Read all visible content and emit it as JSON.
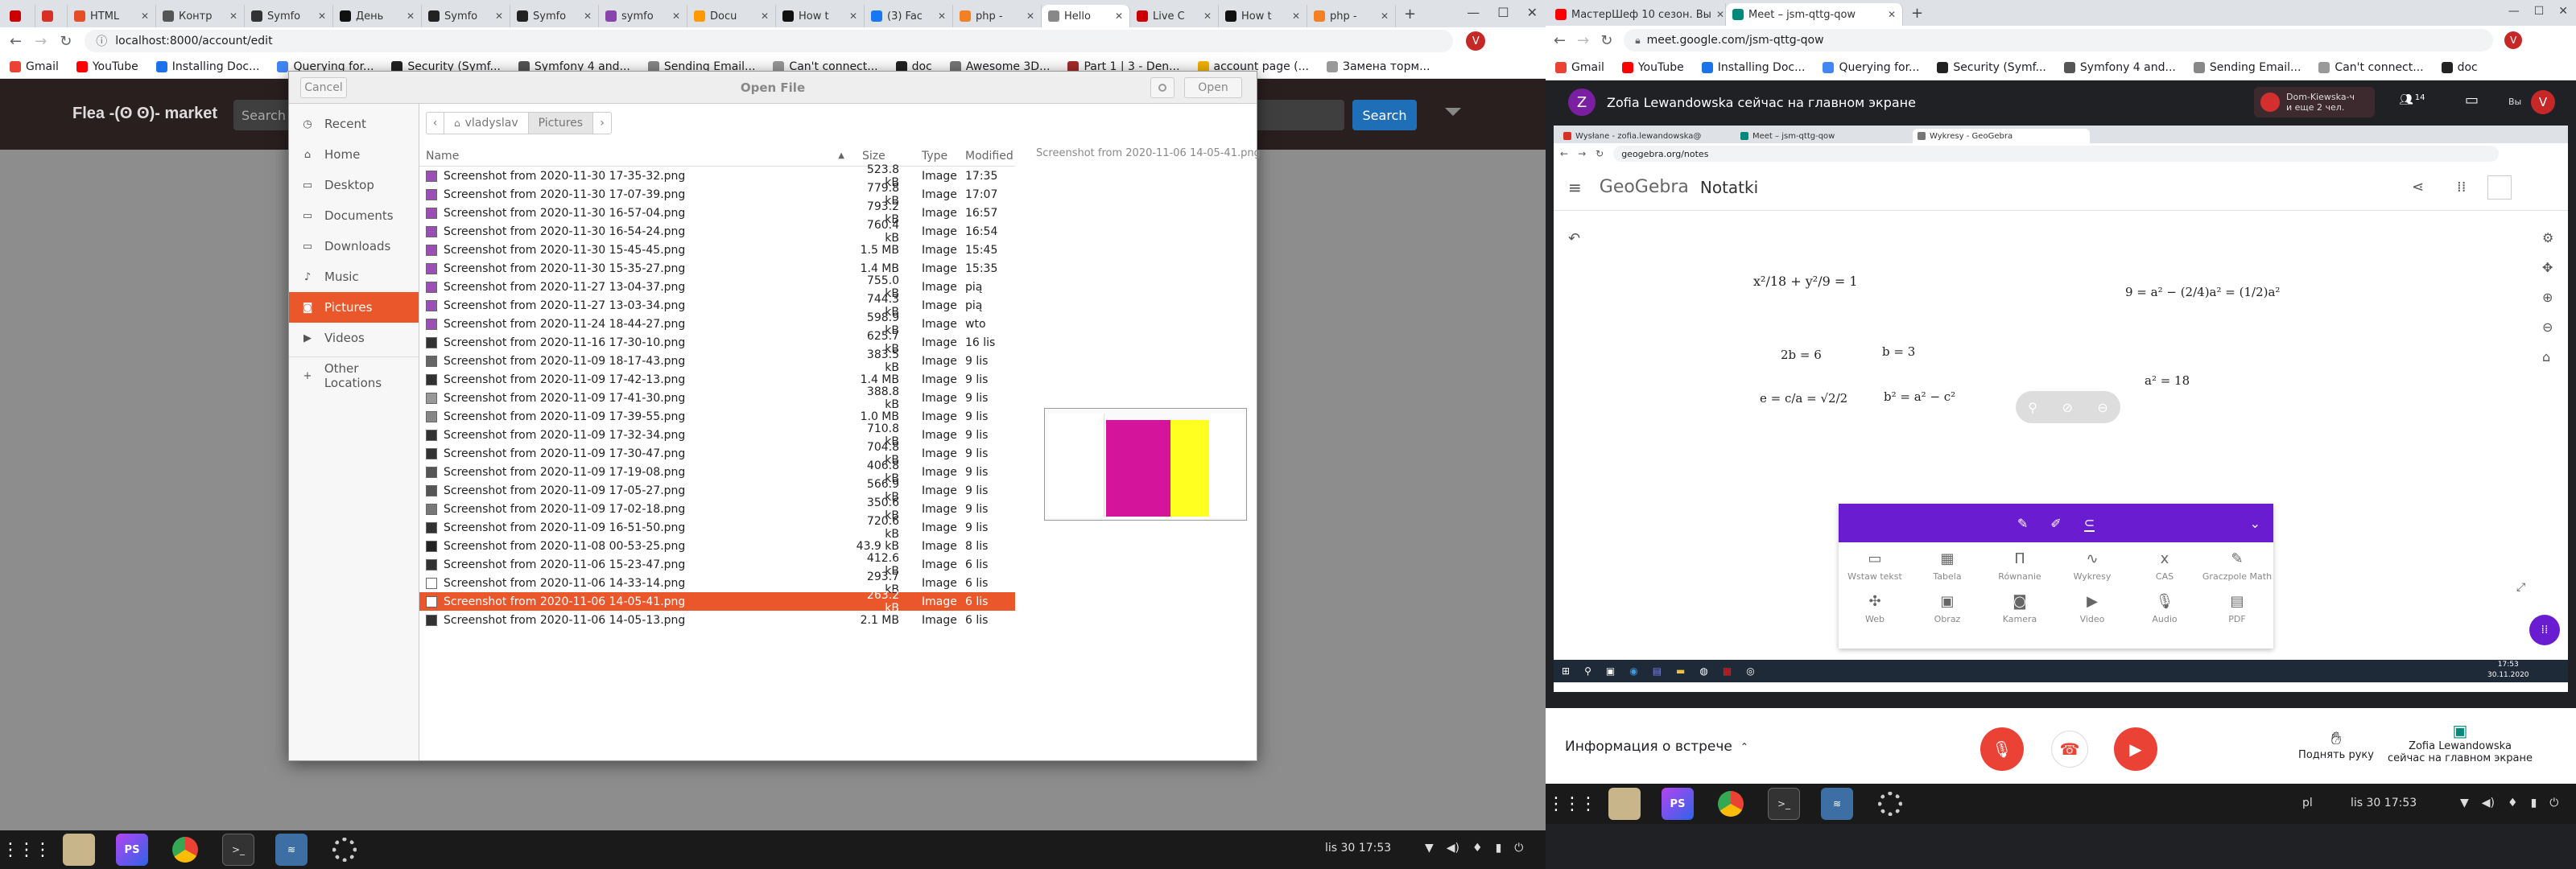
{
  "left_browser": {
    "tabs": [
      {
        "label": "",
        "color": "#cc0000"
      },
      {
        "label": "",
        "color": "#d93025"
      },
      {
        "label": "HTML",
        "color": "#e44d26"
      },
      {
        "label": "Контр",
        "color": "#555555"
      },
      {
        "label": "Symfo",
        "color": "#333333"
      },
      {
        "label": "День",
        "color": "#111111"
      },
      {
        "label": "Symfo",
        "color": "#222222"
      },
      {
        "label": "Symfo",
        "color": "#222222"
      },
      {
        "label": "symfo",
        "color": "#8844aa"
      },
      {
        "label": "Docu",
        "color": "#ff9900"
      },
      {
        "label": "How t",
        "color": "#111111"
      },
      {
        "label": "(3) Fac",
        "color": "#1877f2"
      },
      {
        "label": "php -",
        "color": "#f48024"
      },
      {
        "label": "Hello",
        "color": "#888888"
      },
      {
        "label": "Live C",
        "color": "#cc0000"
      },
      {
        "label": "How t",
        "color": "#111111"
      },
      {
        "label": "php -",
        "color": "#f48024"
      }
    ],
    "url": "localhost:8000/account/edit",
    "bookmarks": [
      "Gmail",
      "YouTube",
      "Installing Doc...",
      "Querying for...",
      "Security (Symf...",
      "Symfony 4 and...",
      "Sending Email...",
      "Can't connect...",
      "doc",
      "Awesome 3D...",
      "Part 1 | 3 - Den...",
      "account page (...",
      "Замена торм..."
    ],
    "site": {
      "logo": "Flea -(ʘ ʘ)- market",
      "search_placeholder": "Search",
      "search_button": "Search"
    }
  },
  "file_dialog": {
    "title": "Open File",
    "cancel_label": "Cancel",
    "open_label": "Open",
    "sidebar": [
      {
        "label": "Recent",
        "icon": "clock-icon"
      },
      {
        "label": "Home",
        "icon": "home-icon"
      },
      {
        "label": "Desktop",
        "icon": "folder-icon"
      },
      {
        "label": "Documents",
        "icon": "folder-icon"
      },
      {
        "label": "Downloads",
        "icon": "folder-icon"
      },
      {
        "label": "Music",
        "icon": "music-icon"
      },
      {
        "label": "Pictures",
        "icon": "camera-icon"
      },
      {
        "label": "Videos",
        "icon": "video-icon"
      },
      {
        "label": "Other Locations",
        "icon": "plus-icon"
      }
    ],
    "active_sidebar": "Pictures",
    "breadcrumb": [
      "vladyslav",
      "Pictures"
    ],
    "columns": {
      "name": "Name",
      "size": "Size",
      "type": "Type",
      "modified": "Modified"
    },
    "files": [
      {
        "name": "Screenshot from 2020-11-30 17-35-32.png",
        "size": "523.8 kB",
        "type": "Image",
        "modified": "17:35"
      },
      {
        "name": "Screenshot from 2020-11-30 17-07-39.png",
        "size": "779.8 kB",
        "type": "Image",
        "modified": "17:07"
      },
      {
        "name": "Screenshot from 2020-11-30 16-57-04.png",
        "size": "793.2 kB",
        "type": "Image",
        "modified": "16:57"
      },
      {
        "name": "Screenshot from 2020-11-30 16-54-24.png",
        "size": "760.4 kB",
        "type": "Image",
        "modified": "16:54"
      },
      {
        "name": "Screenshot from 2020-11-30 15-45-45.png",
        "size": "1.5 MB",
        "type": "Image",
        "modified": "15:45"
      },
      {
        "name": "Screenshot from 2020-11-30 15-35-27.png",
        "size": "1.4 MB",
        "type": "Image",
        "modified": "15:35"
      },
      {
        "name": "Screenshot from 2020-11-27 13-04-37.png",
        "size": "755.0 kB",
        "type": "Image",
        "modified": "pią"
      },
      {
        "name": "Screenshot from 2020-11-27 13-03-34.png",
        "size": "744.3 kB",
        "type": "Image",
        "modified": "pią"
      },
      {
        "name": "Screenshot from 2020-11-24 18-44-27.png",
        "size": "598.9 kB",
        "type": "Image",
        "modified": "wto"
      },
      {
        "name": "Screenshot from 2020-11-16 17-30-10.png",
        "size": "625.7 kB",
        "type": "Image",
        "modified": "16 lis"
      },
      {
        "name": "Screenshot from 2020-11-09 18-17-43.png",
        "size": "383.5 kB",
        "type": "Image",
        "modified": "9 lis"
      },
      {
        "name": "Screenshot from 2020-11-09 17-42-13.png",
        "size": "1.4 MB",
        "type": "Image",
        "modified": "9 lis"
      },
      {
        "name": "Screenshot from 2020-11-09 17-41-30.png",
        "size": "388.8 kB",
        "type": "Image",
        "modified": "9 lis"
      },
      {
        "name": "Screenshot from 2020-11-09 17-39-55.png",
        "size": "1.0 MB",
        "type": "Image",
        "modified": "9 lis"
      },
      {
        "name": "Screenshot from 2020-11-09 17-32-34.png",
        "size": "710.8 kB",
        "type": "Image",
        "modified": "9 lis"
      },
      {
        "name": "Screenshot from 2020-11-09 17-30-47.png",
        "size": "704.8 kB",
        "type": "Image",
        "modified": "9 lis"
      },
      {
        "name": "Screenshot from 2020-11-09 17-19-08.png",
        "size": "406.8 kB",
        "type": "Image",
        "modified": "9 lis"
      },
      {
        "name": "Screenshot from 2020-11-09 17-05-27.png",
        "size": "566.9 kB",
        "type": "Image",
        "modified": "9 lis"
      },
      {
        "name": "Screenshot from 2020-11-09 17-02-18.png",
        "size": "350.6 kB",
        "type": "Image",
        "modified": "9 lis"
      },
      {
        "name": "Screenshot from 2020-11-09 16-51-50.png",
        "size": "720.6 kB",
        "type": "Image",
        "modified": "9 lis"
      },
      {
        "name": "Screenshot from 2020-11-08 00-53-25.png",
        "size": "43.9 kB",
        "type": "Image",
        "modified": "8 lis"
      },
      {
        "name": "Screenshot from 2020-11-06 15-23-47.png",
        "size": "412.6 kB",
        "type": "Image",
        "modified": "6 lis"
      },
      {
        "name": "Screenshot from 2020-11-06 14-33-14.png",
        "size": "293.7 kB",
        "type": "Image",
        "modified": "6 lis"
      },
      {
        "name": "Screenshot from 2020-11-06 14-05-41.png",
        "size": "263.2 kB",
        "type": "Image",
        "modified": "6 lis"
      },
      {
        "name": "Screenshot from 2020-11-06 14-05-13.png",
        "size": "2.1 MB",
        "type": "Image",
        "modified": "6 lis"
      }
    ],
    "selected_index": 23,
    "preview_title": "Screenshot from 2020-11-06 14-05-41.png"
  },
  "left_taskbar": {
    "clock": "lis 30 17:53",
    "apps": [
      "apps-grid-icon",
      "files-icon",
      "phpstorm-icon",
      "chrome-icon",
      "terminal-icon",
      "terminal2-icon",
      "settings-icon"
    ]
  },
  "right_browser": {
    "tabs": [
      {
        "label": "МастерШеф 10 сезон. Вы",
        "color": "#ff0000"
      },
      {
        "label": "Meet – jsm-qttg-qow",
        "color": "#00897b"
      }
    ],
    "url": "meet.google.com/jsm-qttg-qow",
    "bookmarks": [
      "Gmail",
      "YouTube",
      "Installing Doc...",
      "Querying for...",
      "Security (Symf...",
      "Symfony 4 and...",
      "Sending Email...",
      "Can't connect...",
      "doc"
    ],
    "avatar_letter": "V"
  },
  "meet": {
    "presenter_letter": "Z",
    "presenter_text": "Zofia Lewandowska сейчас на главном экране",
    "participant_notice": "Dom-Kiewska-ч\nи еще 2 чел.",
    "participants_count": "14",
    "you_label": "Вы",
    "avatar_letter": "V",
    "meeting_info": "Информация о встрече",
    "raise_hand": "Поднять руку",
    "presenting_label": "Zofia Lewandowska\nсейчас на главном экране"
  },
  "shared_screen": {
    "tabs": [
      {
        "label": "Wysłane - zofia.lewandowska@",
        "color": "#d93025"
      },
      {
        "label": "Meet – jsm-qttg-qow",
        "color": "#00897b"
      },
      {
        "label": "Wykresy - GeoGebra",
        "color": "#777777"
      }
    ],
    "url": "geogebra.org/notes",
    "app_name": "GeoGebra",
    "page_title": "Notatki",
    "notes": {
      "ellipse": "x²/18 + y²/9 = 1",
      "two_b": "2b = 6",
      "b": "b = 3",
      "e": "e = c/a = √2/2",
      "b_sq": "b² = a² − c²",
      "nine": "9 = a² − (2/4)a² = (1/2)a²",
      "a_sq": "a² = 18"
    },
    "tools": [
      {
        "label": "Wstaw tekst",
        "icon": "text-icon"
      },
      {
        "label": "Tabela",
        "icon": "table-icon"
      },
      {
        "label": "Równanie",
        "icon": "equation-icon"
      },
      {
        "label": "Wykresy",
        "icon": "graph-icon"
      },
      {
        "label": "CAS",
        "icon": "cas-icon"
      },
      {
        "label": "Graczpole Math",
        "icon": "math-icon"
      },
      {
        "label": "Web",
        "icon": "puzzle-icon"
      },
      {
        "label": "Obraz",
        "icon": "image-icon"
      },
      {
        "label": "Kamera",
        "icon": "camera-icon"
      },
      {
        "label": "Video",
        "icon": "video-icon"
      },
      {
        "label": "Audio",
        "icon": "mic-icon"
      },
      {
        "label": "PDF",
        "icon": "pdf-icon"
      }
    ],
    "clock": "17:53",
    "date": "30.11.2020"
  },
  "right_taskbar": {
    "lang": "pl",
    "clock": "lis 30 17:53"
  },
  "colors": {
    "accent_orange": "#e9572a",
    "geogebra_purple": "#6a1cd1",
    "meet_dark": "#202124",
    "meet_red": "#ea4335"
  }
}
